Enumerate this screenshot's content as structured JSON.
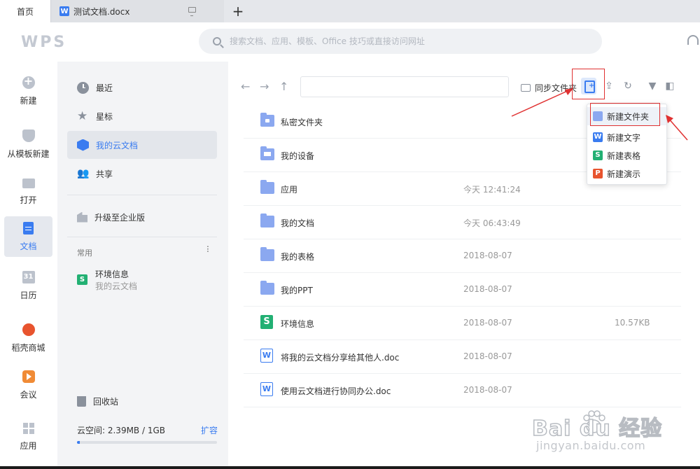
{
  "tabs": {
    "home": "首页",
    "doc_title": "测试文档.docx",
    "doc_icon": "W",
    "plus": "+"
  },
  "header": {
    "logo": "WPS",
    "search_placeholder": "搜索文档、应用、模板、Office 技巧或直接访问网址"
  },
  "leftnav": {
    "items": [
      {
        "label": "新建",
        "icon": "plus-circle-icon"
      },
      {
        "label": "从模板新建",
        "icon": "template-icon"
      },
      {
        "label": "打开",
        "icon": "folder-icon"
      },
      {
        "label": "文档",
        "icon": "document-icon"
      },
      {
        "label": "日历",
        "icon": "calendar-icon",
        "glyph": "31"
      },
      {
        "label": "稻壳商城",
        "icon": "shop-icon"
      },
      {
        "label": "会议",
        "icon": "meeting-icon"
      },
      {
        "label": "应用",
        "icon": "apps-icon"
      }
    ]
  },
  "sidebar": {
    "items": [
      {
        "label": "最近"
      },
      {
        "label": "星标"
      },
      {
        "label": "我的云文档"
      },
      {
        "label": "共享"
      },
      {
        "label": "升级至企业版"
      }
    ],
    "common": {
      "heading": "常用",
      "more": "···",
      "item_name": "环境信息",
      "item_sub": "我的云文档",
      "item_icon": "S"
    },
    "trash": "回收站",
    "storage": {
      "text": "云空间: 2.39MB / 1GB",
      "expand": "扩容",
      "used_fraction": 0.0023
    }
  },
  "toolbar": {
    "back": "←",
    "forward": "→",
    "up": "↑",
    "path_value": "",
    "sync_label": "同步文件夹",
    "upload": "⇪",
    "refresh": "↻",
    "filter": "▼",
    "panel": "◧"
  },
  "files": [
    {
      "name": "私密文件夹",
      "date": "",
      "size": "",
      "type": "lock-folder"
    },
    {
      "name": "我的设备",
      "date": "",
      "size": "",
      "type": "device-folder"
    },
    {
      "name": "应用",
      "date": "今天 12:41:24",
      "size": "",
      "type": "folder"
    },
    {
      "name": "我的文档",
      "date": "今天 06:43:49",
      "size": "",
      "type": "folder"
    },
    {
      "name": "我的表格",
      "date": "2018-08-07",
      "size": "",
      "type": "folder"
    },
    {
      "name": "我的PPT",
      "date": "2018-08-07",
      "size": "",
      "type": "folder"
    },
    {
      "name": "环境信息",
      "date": "2018-08-07",
      "size": "10.57KB",
      "type": "sheet",
      "glyph": "S"
    },
    {
      "name": "将我的云文档分享给其他人.doc",
      "date": "2018-08-07",
      "size": "",
      "type": "word",
      "glyph": "W"
    },
    {
      "name": "使用云文档进行协同办公.doc",
      "date": "2018-08-07",
      "size": "",
      "type": "word",
      "glyph": "W"
    }
  ],
  "dropdown": {
    "items": [
      {
        "label": "新建文件夹",
        "glyph": ""
      },
      {
        "label": "新建文字",
        "glyph": "W"
      },
      {
        "label": "新建表格",
        "glyph": "S"
      },
      {
        "label": "新建演示",
        "glyph": "P"
      }
    ]
  },
  "colors": {
    "accent": "#3a7cf0",
    "sheet_green": "#22b073",
    "ppt_orange": "#e8542e",
    "folder_blue": "#8ba8f0",
    "annotation_red": "#e03131"
  },
  "watermark": {
    "brand": "Bai du 经验",
    "url": "jingyan.baidu.com"
  }
}
